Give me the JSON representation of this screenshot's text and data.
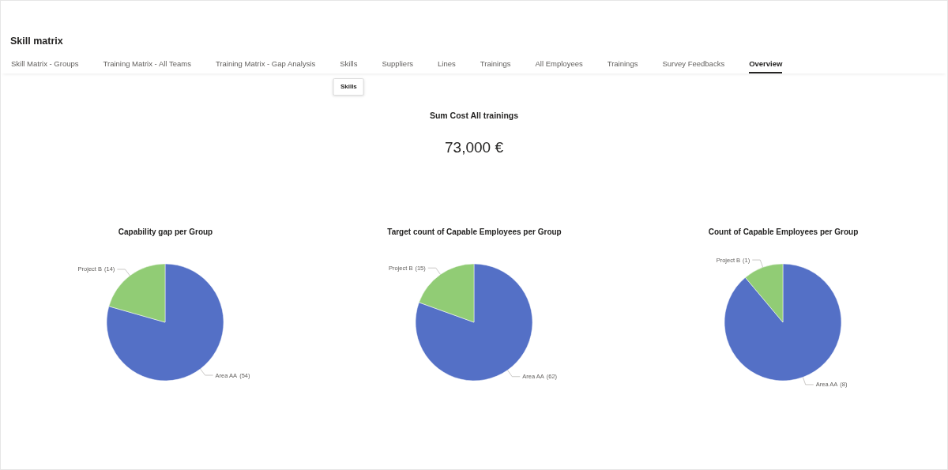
{
  "page": {
    "title": "Skill matrix"
  },
  "tabs": [
    {
      "label": "Skill Matrix - Groups",
      "selected": false
    },
    {
      "label": "Training Matrix - All Teams",
      "selected": false
    },
    {
      "label": "Training Matrix - Gap Analysis",
      "selected": false
    },
    {
      "label": "Skills",
      "selected": false,
      "tooltip": "Skills"
    },
    {
      "label": "Suppliers",
      "selected": false
    },
    {
      "label": "Lines",
      "selected": false
    },
    {
      "label": "Trainings",
      "selected": false
    },
    {
      "label": "All Employees",
      "selected": false
    },
    {
      "label": "Trainings",
      "selected": false
    },
    {
      "label": "Survey Feedbacks",
      "selected": false
    },
    {
      "label": "Overview",
      "selected": true
    }
  ],
  "kpi": {
    "title": "Sum Cost All trainings",
    "value": "73,000 €"
  },
  "charts": [
    {
      "chart_data": {
        "type": "pie",
        "title": "Capability gap per Group",
        "categories": [
          "Area AA",
          "Project B"
        ],
        "values": [
          54,
          14
        ],
        "colors": [
          "#5470c6",
          "#91cc75"
        ],
        "value_labels": [
          "(54)",
          "(14)"
        ]
      }
    },
    {
      "chart_data": {
        "type": "pie",
        "title": "Target count of Capable Employees per Group",
        "categories": [
          "Area AA",
          "Project B"
        ],
        "values": [
          62,
          15
        ],
        "colors": [
          "#5470c6",
          "#91cc75"
        ],
        "value_labels": [
          "(62)",
          "(15)"
        ]
      }
    },
    {
      "chart_data": {
        "type": "pie",
        "title": "Count of Capable Employees per Group",
        "categories": [
          "Area AA",
          "Project B"
        ],
        "values": [
          8,
          1
        ],
        "colors": [
          "#5470c6",
          "#91cc75"
        ],
        "value_labels": [
          "(8)",
          "(1)"
        ]
      }
    }
  ]
}
